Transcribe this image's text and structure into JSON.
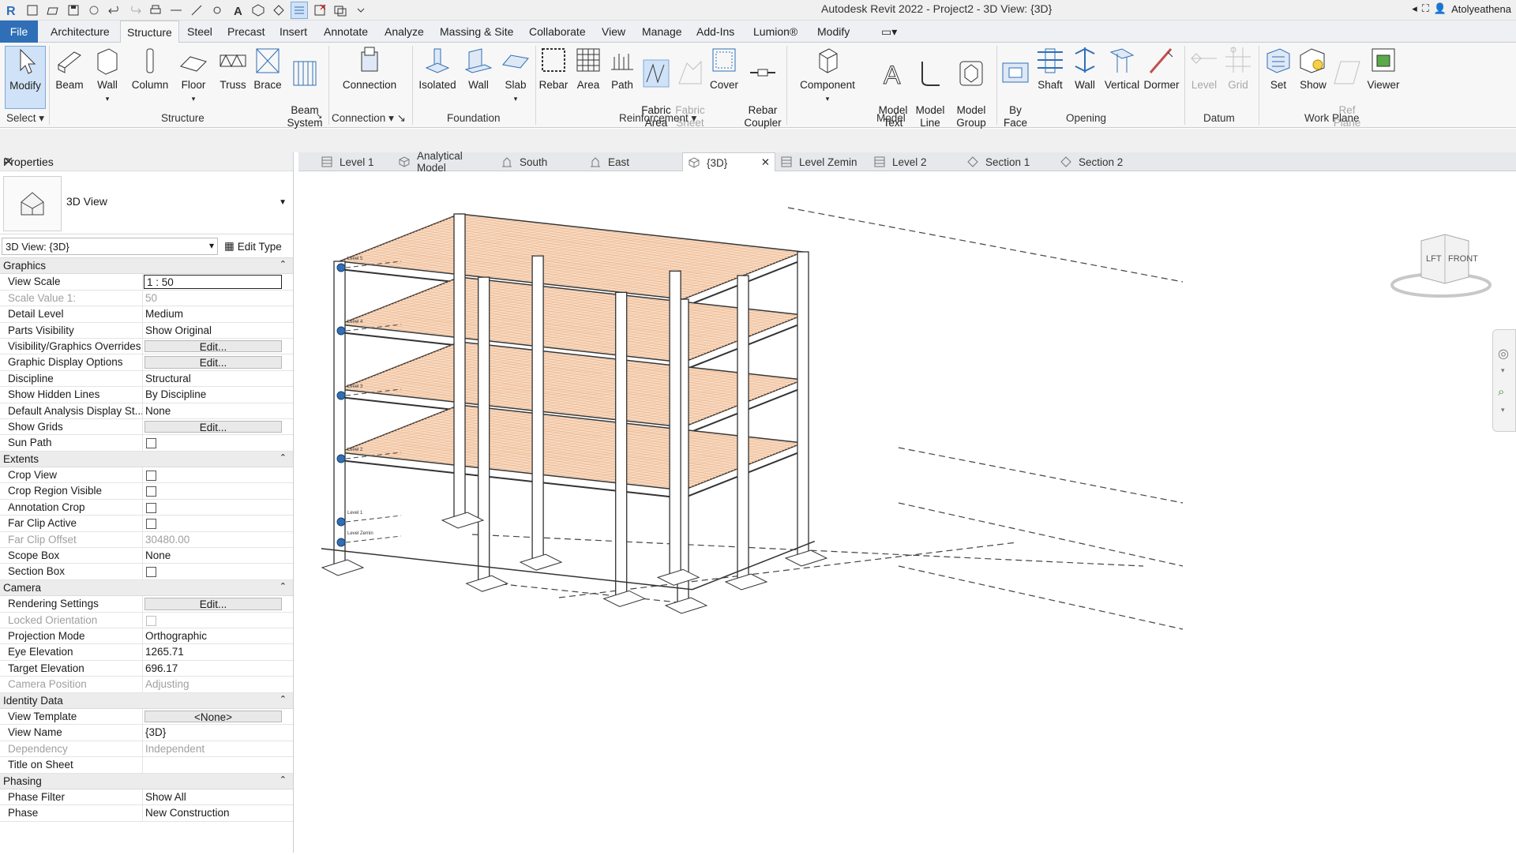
{
  "window": {
    "title": "Autodesk Revit 2022 - Project2 - 3D View: {3D}",
    "user": "Atolyeathena"
  },
  "menu_tabs": [
    "File",
    "Architecture",
    "Structure",
    "Steel",
    "Precast",
    "Insert",
    "Annotate",
    "Analyze",
    "Massing & Site",
    "Collaborate",
    "View",
    "Manage",
    "Add-Ins",
    "Lumion®",
    "Modify"
  ],
  "active_tab": "Structure",
  "ribbon": {
    "buttons": {
      "modify": "Modify",
      "beam": "Beam",
      "wall": "Wall",
      "column": "Column",
      "floor": "Floor",
      "truss": "Truss",
      "brace": "Brace",
      "beam_system": "Beam\nSystem",
      "connection": "Connection",
      "isolated": "Isolated",
      "found_wall": "Wall",
      "slab": "Slab",
      "rebar": "Rebar",
      "area": "Area",
      "path": "Path",
      "fabric_area": "Fabric\nArea",
      "fabric_sheet": "Fabric\nSheet",
      "cover": "Cover",
      "rebar_coupler": "Rebar\nCoupler",
      "component": "Component",
      "model_text": "Model\nText",
      "model_line": "Model\nLine",
      "model_group": "Model\nGroup",
      "by_face": "By\nFace",
      "shaft": "Shaft",
      "open_wall": "Wall",
      "vertical": "Vertical",
      "dormer": "Dormer",
      "level": "Level",
      "grid": "Grid",
      "set": "Set",
      "show": "Show",
      "ref_plane": "Ref\nPlane",
      "viewer": "Viewer"
    },
    "panels": {
      "select": "Select",
      "structure": "Structure",
      "connection": "Connection",
      "foundation": "Foundation",
      "reinforcement": "Reinforcement",
      "model": "Model",
      "opening": "Opening",
      "datum": "Datum",
      "work_plane": "Work Plane"
    }
  },
  "properties": {
    "header": "Properties",
    "type_name": "3D View",
    "selector": "3D View: {3D}",
    "edit_type": "Edit Type",
    "groups": [
      {
        "name": "Graphics",
        "rows": [
          {
            "k": "View Scale",
            "v": "1 : 50",
            "kind": "input"
          },
          {
            "k": "Scale Value    1:",
            "v": "50",
            "kind": "text",
            "dim": true
          },
          {
            "k": "Detail Level",
            "v": "Medium",
            "kind": "text"
          },
          {
            "k": "Parts Visibility",
            "v": "Show Original",
            "kind": "text"
          },
          {
            "k": "Visibility/Graphics Overrides",
            "v": "Edit...",
            "kind": "button"
          },
          {
            "k": "Graphic Display Options",
            "v": "Edit...",
            "kind": "button"
          },
          {
            "k": "Discipline",
            "v": "Structural",
            "kind": "text"
          },
          {
            "k": "Show Hidden Lines",
            "v": "By Discipline",
            "kind": "text"
          },
          {
            "k": "Default Analysis Display St...",
            "v": "None",
            "kind": "text"
          },
          {
            "k": "Show Grids",
            "v": "Edit...",
            "kind": "button"
          },
          {
            "k": "Sun Path",
            "v": "",
            "kind": "check"
          }
        ]
      },
      {
        "name": "Extents",
        "rows": [
          {
            "k": "Crop View",
            "v": "",
            "kind": "check"
          },
          {
            "k": "Crop Region Visible",
            "v": "",
            "kind": "check"
          },
          {
            "k": "Annotation Crop",
            "v": "",
            "kind": "check"
          },
          {
            "k": "Far Clip Active",
            "v": "",
            "kind": "check"
          },
          {
            "k": "Far Clip Offset",
            "v": "30480.00",
            "kind": "text",
            "dim": true
          },
          {
            "k": "Scope Box",
            "v": "None",
            "kind": "text"
          },
          {
            "k": "Section Box",
            "v": "",
            "kind": "check"
          }
        ]
      },
      {
        "name": "Camera",
        "rows": [
          {
            "k": "Rendering Settings",
            "v": "Edit...",
            "kind": "button"
          },
          {
            "k": "Locked Orientation",
            "v": "",
            "kind": "check",
            "dim": true
          },
          {
            "k": "Projection Mode",
            "v": "Orthographic",
            "kind": "text"
          },
          {
            "k": "Eye Elevation",
            "v": "1265.71",
            "kind": "text"
          },
          {
            "k": "Target Elevation",
            "v": "696.17",
            "kind": "text"
          },
          {
            "k": "Camera Position",
            "v": "Adjusting",
            "kind": "text",
            "dim": true
          }
        ]
      },
      {
        "name": "Identity Data",
        "rows": [
          {
            "k": "View Template",
            "v": "<None>",
            "kind": "button"
          },
          {
            "k": "View Name",
            "v": "{3D}",
            "kind": "text"
          },
          {
            "k": "Dependency",
            "v": "Independent",
            "kind": "text",
            "dim": true
          },
          {
            "k": "Title on Sheet",
            "v": "",
            "kind": "text"
          }
        ]
      },
      {
        "name": "Phasing",
        "rows": [
          {
            "k": "Phase Filter",
            "v": "Show All",
            "kind": "text"
          },
          {
            "k": "Phase",
            "v": "New Construction",
            "kind": "text"
          }
        ]
      }
    ]
  },
  "view_tabs": [
    "Level 1",
    "Analytical Model",
    "South",
    "East",
    "{3D}",
    "Level Zemin",
    "Level 2",
    "Section 1",
    "Section 2"
  ],
  "active_view": "{3D}",
  "viewcube": {
    "left": "LFT",
    "front": "FRONT"
  },
  "level_labels": [
    "Level 5",
    "Level 4",
    "Level 3",
    "Level 2",
    "Level 1",
    "Level Zemin"
  ],
  "colors": {
    "accent": "#2f6fb7",
    "slab_hatch": "#e8a06a",
    "structure_line": "#333333"
  }
}
